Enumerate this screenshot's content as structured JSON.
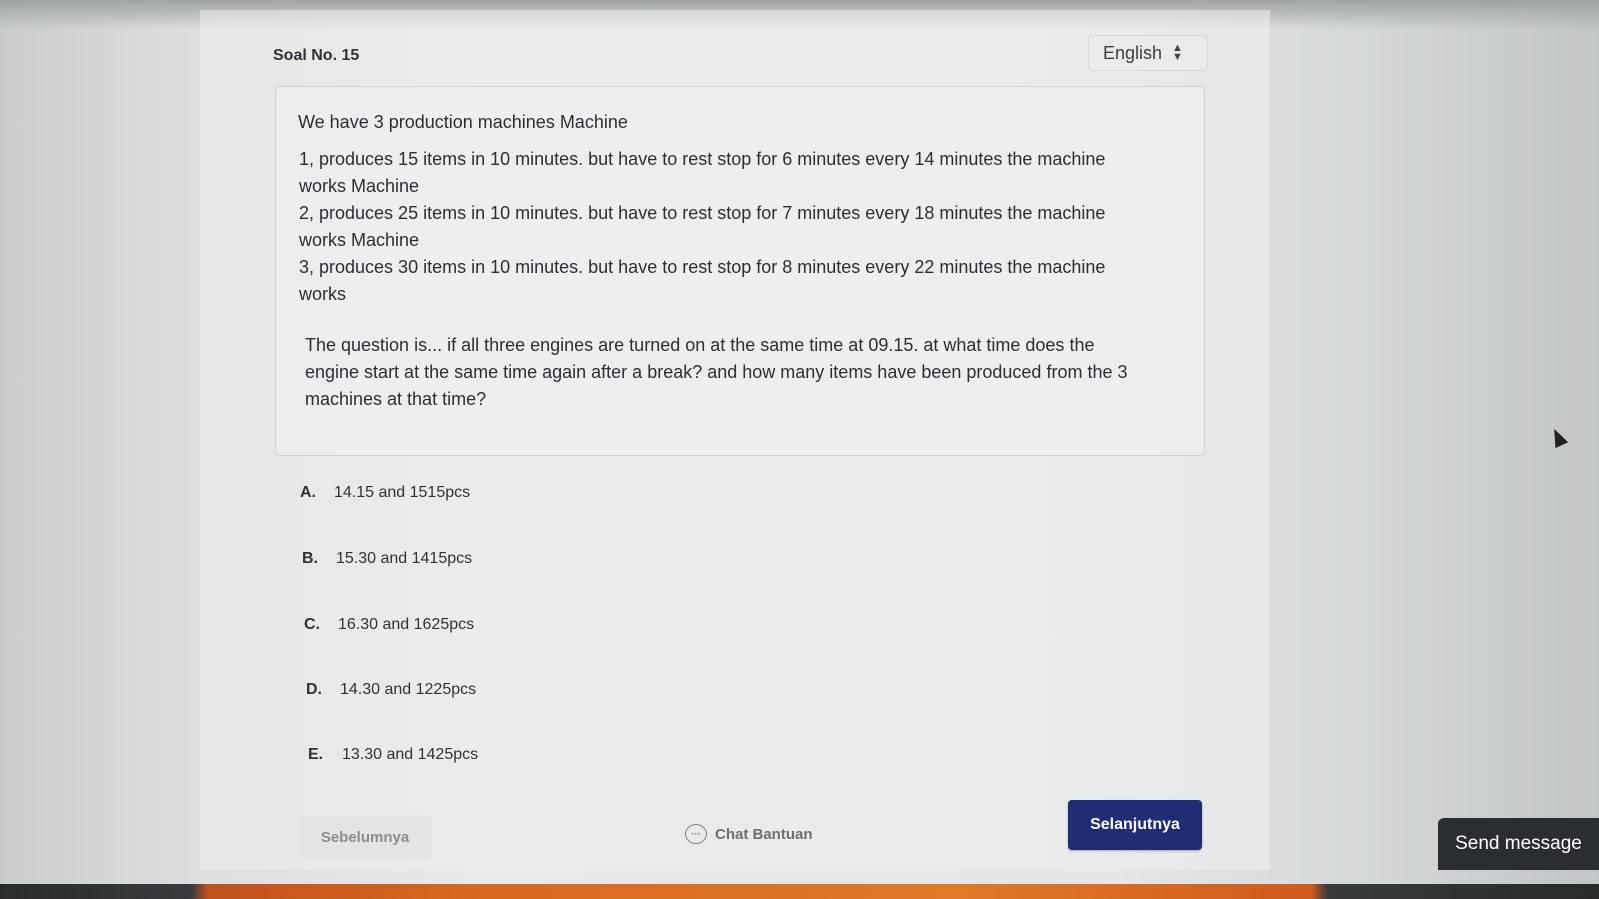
{
  "header": {
    "question_number": "Soal No. 15",
    "language": "English"
  },
  "question": {
    "intro": "We have 3 production machines Machine",
    "lines": [
      "1, produces 15 items in 10 minutes. but have to rest stop for 6 minutes every 14 minutes the machine",
      "works Machine",
      "2, produces 25 items in 10 minutes. but have to rest stop for 7 minutes every 18 minutes the machine",
      "works Machine",
      "3, produces 30 items in 10 minutes. but have to rest stop for 8 minutes every 22 minutes the machine",
      "works"
    ],
    "prompt_lines": [
      "The question is... if all three engines are turned on at the same time at 09.15. at what time does the",
      "engine start at the same time again after a break? and how many items have been produced from the 3",
      "machines at that time?"
    ]
  },
  "options": [
    {
      "letter": "A.",
      "text": "14.15 and 1515pcs"
    },
    {
      "letter": "B.",
      "text": "15.30 and 1415pcs"
    },
    {
      "letter": "C.",
      "text": "16.30 and 1625pcs"
    },
    {
      "letter": "D.",
      "text": "14.30 and 1225pcs"
    },
    {
      "letter": "E.",
      "text": "13.30 and 1425pcs"
    }
  ],
  "footer": {
    "prev_label": "Sebelumnya",
    "chat_label": "Chat Bantuan",
    "next_label": "Selanjutnya"
  },
  "widget": {
    "send_message_label": "Send message"
  },
  "colors": {
    "primary_button": "#1e2d74",
    "text": "#2a2e33"
  }
}
